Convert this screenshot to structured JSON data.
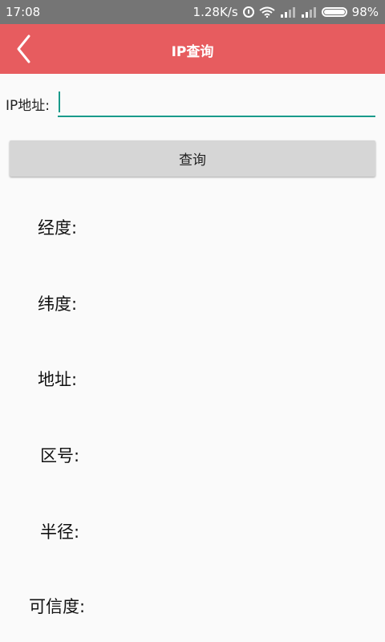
{
  "status_bar": {
    "time": "17:08",
    "network_speed": "1.28K/s",
    "battery": "98%",
    "icons": [
      "alarm-icon",
      "wifi-icon",
      "signal-icon",
      "signal-icon",
      "battery-icon"
    ]
  },
  "app_bar": {
    "title": "IP查询",
    "back_icon": "chevron-left-icon",
    "color": "#e75c5f"
  },
  "form": {
    "ip_label": "IP地址:",
    "ip_value": "",
    "query_button": "查询",
    "accent": "#199a8b"
  },
  "results": {
    "longitude": "经度:",
    "latitude": "纬度:",
    "address": "地址:",
    "area_code": "区号:",
    "radius": "半径:",
    "confidence": "可信度:"
  }
}
